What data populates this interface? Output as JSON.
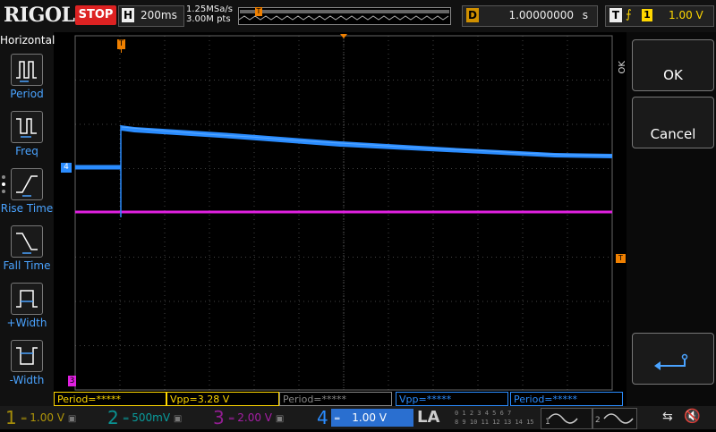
{
  "topbar": {
    "logo": "RIGOL",
    "run_state": "STOP",
    "timebase_key": "H",
    "timebase_value": "200ms",
    "sample_rate": "1.25MSa/s",
    "memory_depth": "3.00M pts",
    "buffer_trigger_marker": "T",
    "delay_key": "D",
    "delay_value": "1.00000000",
    "delay_unit": "s",
    "trigger_key": "T",
    "trigger_slope_icon": "rising-edge-icon",
    "trigger_source": "1",
    "trigger_level": "1.00 V"
  },
  "left_panel": {
    "title": "Horizontal",
    "items": [
      {
        "label": "Period",
        "icon": "period-icon"
      },
      {
        "label": "Freq",
        "icon": "frequency-icon"
      },
      {
        "label": "Rise Time",
        "icon": "rise-time-icon"
      },
      {
        "label": "Fall Time",
        "icon": "fall-time-icon"
      },
      {
        "label": "+Width",
        "icon": "positive-width-icon"
      },
      {
        "label": "-Width",
        "icon": "negative-width-icon"
      }
    ]
  },
  "screen": {
    "trigger_pos_marker": "T",
    "trigger_level_marker": "T",
    "ch4_marker": "4",
    "ch3_marker": "3",
    "colors": {
      "ch1": "#ffd700",
      "ch2": "#00e0e0",
      "ch3": "#e020e0",
      "ch4": "#2a8cff"
    }
  },
  "right_panel": {
    "side_label": "OK",
    "ok_label": "OK",
    "cancel_label": "Cancel",
    "enter_icon": "enter-icon"
  },
  "measurements": [
    {
      "text": "Period=*****",
      "color": "#ffd700"
    },
    {
      "text": "Vpp=3.28 V",
      "color": "#ffd700"
    },
    {
      "text": "Period=*****",
      "color": "#888888"
    },
    {
      "text": "Vpp=*****",
      "color": "#2a8cff"
    },
    {
      "text": "Period=*****",
      "color": "#2a8cff"
    }
  ],
  "channels": [
    {
      "num": "1",
      "scale": "1.00 V",
      "color": "#ffd700",
      "active": false
    },
    {
      "num": "2",
      "scale": "500mV",
      "color": "#00e0e0",
      "active": false
    },
    {
      "num": "3",
      "scale": "2.00 V",
      "color": "#e020e0",
      "active": false
    },
    {
      "num": "4",
      "scale": "1.00 V",
      "color": "#2a8cff",
      "active": true
    }
  ],
  "bottom": {
    "la_label": "LA",
    "la_row1": "0 1 2 3  4 5 6 7",
    "la_row2": "8 9 10 11  12 13 14 15",
    "gen1": "1",
    "gen2": "2",
    "usb_icon": "usb-icon",
    "speaker_icon": "speaker-muted-icon"
  }
}
